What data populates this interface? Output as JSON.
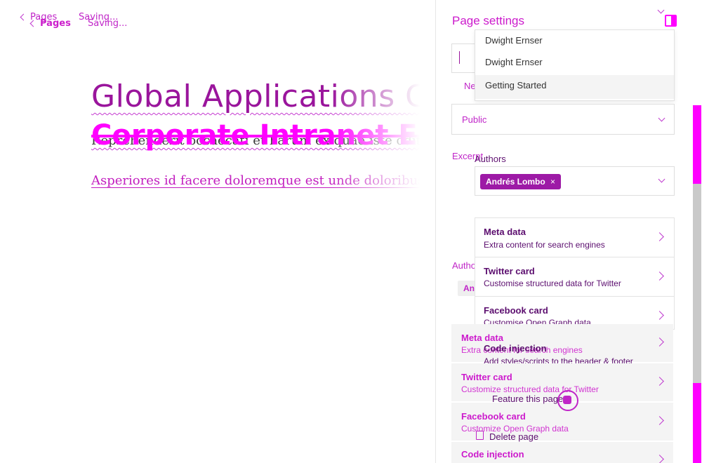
{
  "editor": {
    "back_label": "Pages",
    "status": "Saving...",
    "title": "Global Applications Coo",
    "title_ghost": "Corporate Intranet Eng",
    "excerpt_line": "Reprehenderit occaecati et harum ex quae iste odit a quo.",
    "body_line": "Asperiores id facere doloremque est unde doloribus un"
  },
  "panel": {
    "title": "Page settings",
    "author_options": [
      "Dwight Ernser",
      "Dwight Ernser",
      "Getting Started"
    ],
    "tag_ghost": "News",
    "visibility_value": "Public",
    "excerpt_label": "Excerpt",
    "authors_label": "Authors",
    "author_token": "Andrés Lombo",
    "token_remove_glyph": "×",
    "authors_label_ghost": "Authors",
    "cards": [
      {
        "title": "Meta data",
        "subtitle": "Extra content for search engines"
      },
      {
        "title": "Twitter card",
        "subtitle": "Customise structured data for Twitter"
      },
      {
        "title": "Facebook card",
        "subtitle": "Customise Open Graph data"
      },
      {
        "title": "Code injection",
        "subtitle": "Add styles/scripts to the header & footer"
      }
    ],
    "cards_ghost": [
      {
        "title": "Meta data",
        "subtitle": "Extra content for search engines"
      },
      {
        "title": "Twitter card",
        "subtitle": "Customize structured data for Twitter"
      },
      {
        "title": "Facebook card",
        "subtitle": "Customize Open Graph data"
      },
      {
        "title": "Code injection",
        "subtitle": ""
      }
    ],
    "feature_label": "Feature this page",
    "delete_label": "Delete page"
  },
  "colors": {
    "accent": "#ff00ff",
    "accent_dark": "#9a159c",
    "text_purple": "#c025c8"
  }
}
